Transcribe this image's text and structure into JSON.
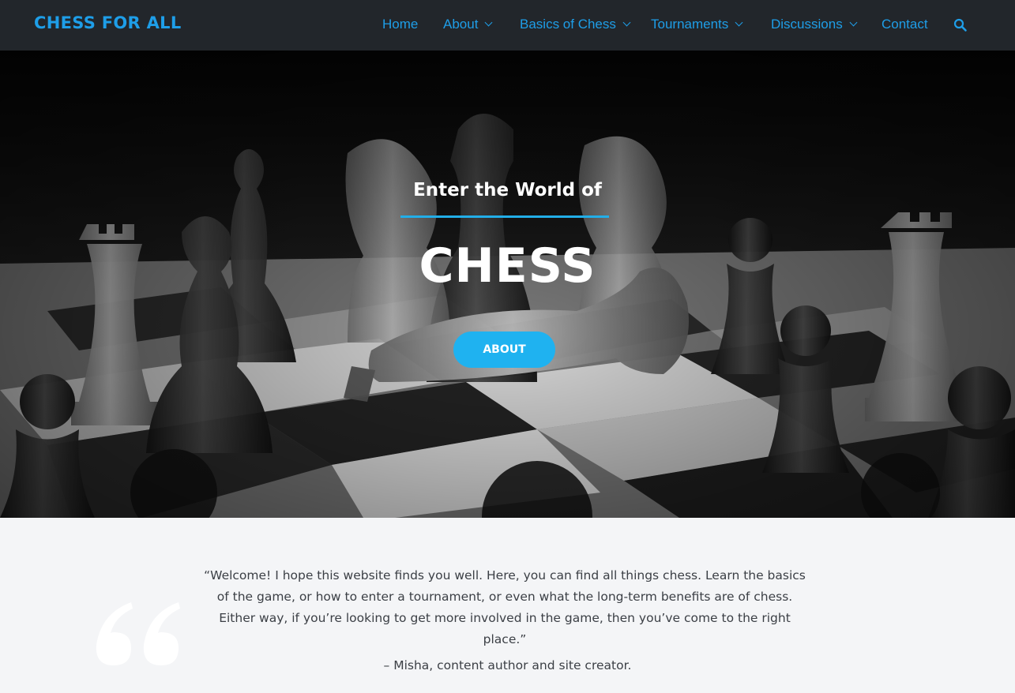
{
  "site": {
    "logo": "CHESS FOR ALL"
  },
  "nav": {
    "items": [
      {
        "label": "Home",
        "dropdown": false
      },
      {
        "label": "About",
        "dropdown": true
      },
      {
        "label": "Basics of Chess",
        "dropdown": true
      },
      {
        "label": "Tournaments",
        "dropdown": true
      },
      {
        "label": "Discussions",
        "dropdown": true
      },
      {
        "label": "Contact",
        "dropdown": false
      }
    ],
    "search_icon": "search-icon"
  },
  "hero": {
    "subtitle": "Enter the World of",
    "title": "CHESS",
    "button_label": "ABOUT"
  },
  "quote": {
    "text": "“Welcome! I hope this website finds you well. Here, you can find all things chess. Learn the basics of the game, or how to enter a tournament, or even what the long-term benefits are of chess. Either way, if you’re looking to get more involved in the game, then you’ve come to the right place.”",
    "author": "– Misha, content author and site creator.",
    "icon": "quote-mark-icon"
  },
  "colors": {
    "header_bg": "#22262b",
    "accent": "#1e9ee8",
    "button": "#1fb2f0",
    "section_bg": "#f4f5f7"
  }
}
